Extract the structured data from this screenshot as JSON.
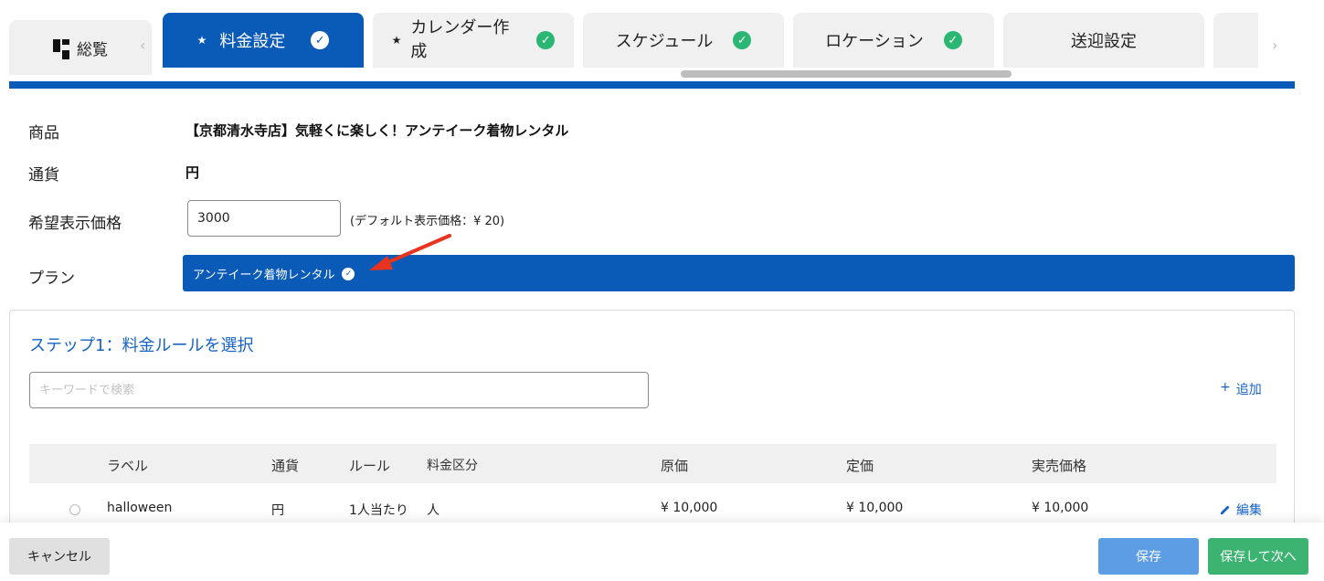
{
  "tabs": {
    "overview": "総覧",
    "items": [
      {
        "label": "料金設定",
        "starred": true,
        "done": true,
        "active": true
      },
      {
        "label": "カレンダー作成",
        "starred": true,
        "done": true,
        "active": false
      },
      {
        "label": "スケジュール",
        "starred": false,
        "done": true,
        "active": false
      },
      {
        "label": "ロケーション",
        "starred": false,
        "done": true,
        "active": false
      },
      {
        "label": "送迎設定",
        "starred": false,
        "done": false,
        "active": false
      }
    ],
    "prev_glyph": "‹",
    "next_glyph": "›",
    "check_glyph": "✓",
    "star_glyph": "★"
  },
  "form": {
    "product_label": "商品",
    "product_value": "【京都清水寺店】気軽くに楽しく！アンテイーク着物レンタル",
    "currency_label": "通貨",
    "currency_value": "円",
    "price_label": "希望表示価格",
    "price_value": "3000",
    "default_price": "(デフォルト表示価格：¥ 20)",
    "plan_label": "プラン",
    "plan_chip": "アンテイーク着物レンタル"
  },
  "step": {
    "title": "ステップ1：料金ルールを選択",
    "search_placeholder": "キーワードで検索",
    "add_icon": "+",
    "add_label": "追加"
  },
  "table": {
    "headers": [
      "ラベル",
      "通貨",
      "ルール",
      "料金区分",
      "原価",
      "定価",
      "実売価格"
    ],
    "rows": [
      {
        "label": "halloween",
        "currency": "円",
        "rule": "1人当たり",
        "category": "人",
        "cost": "¥ 10,000",
        "list_price": "¥ 10,000",
        "sale_price": "¥ 10,000"
      }
    ],
    "edit_label": "編集"
  },
  "footer": {
    "cancel": "キャンセル",
    "save": "保存",
    "save_next": "保存して次へ"
  },
  "colors": {
    "primary": "#0a5ab8",
    "done": "#2bb673",
    "link": "#1763c4",
    "annotation_arrow": "#e8331e"
  }
}
